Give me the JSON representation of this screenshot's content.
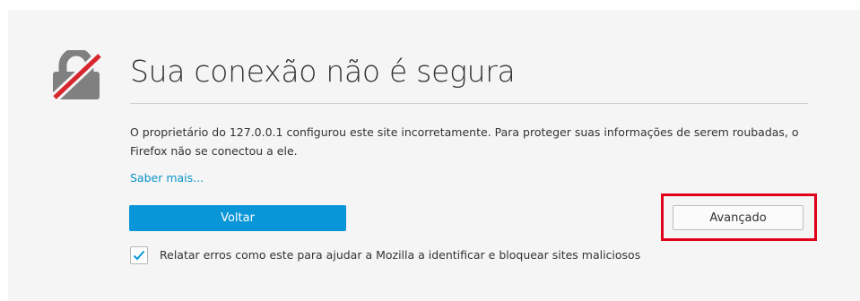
{
  "error_page": {
    "title": "Sua conexão não é segura",
    "description": "O proprietário do 127.0.0.1 configurou este site incorretamente. Para proteger suas informações de serem roubadas, o Firefox não se conectou a ele.",
    "learn_more": "Saber mais...",
    "back_button": "Voltar",
    "advanced_button": "Avançado",
    "report_checkbox": {
      "checked": true,
      "label": "Relatar erros como este para ajudar a Mozilla a identificar e bloquear sites maliciosos"
    }
  },
  "colors": {
    "accent": "#0996d8",
    "highlight": "#e0001b",
    "lock_body": "#808080",
    "lock_strike": "#d7262e"
  },
  "icons": [
    "broken-lock-icon",
    "checkmark-icon"
  ]
}
